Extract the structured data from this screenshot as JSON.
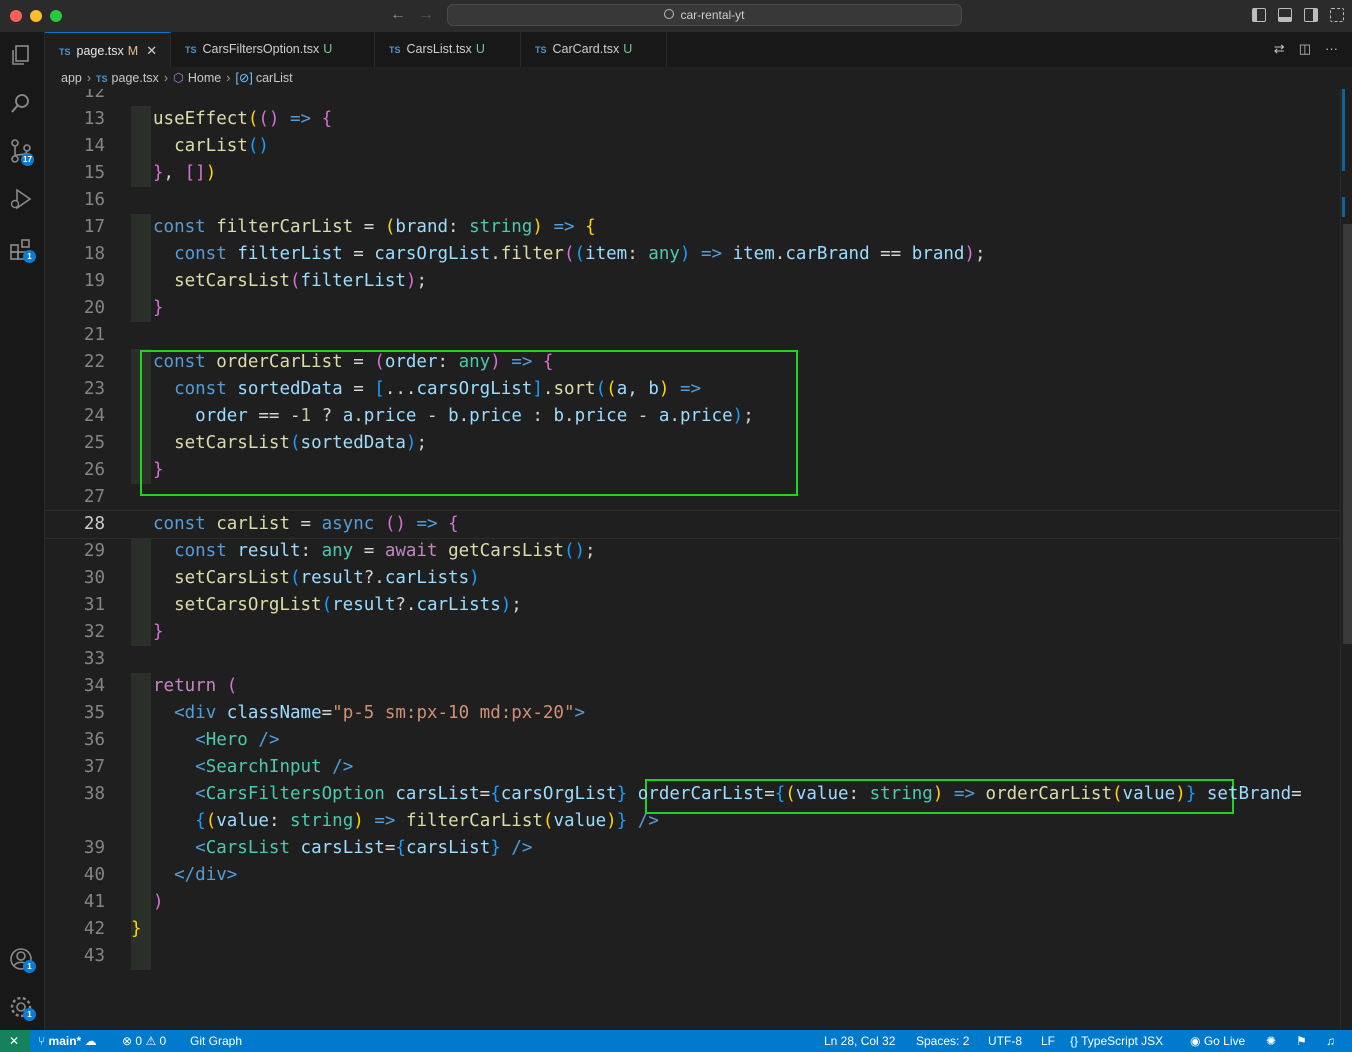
{
  "window": {
    "search_text": "car-rental-yt",
    "traffic_lights": {
      "close": "#ff5f57",
      "min": "#febc2e",
      "max": "#28c840"
    }
  },
  "activity_bar": {
    "items": [
      {
        "icon": "files-icon"
      },
      {
        "icon": "search-icon"
      },
      {
        "icon": "source-control-icon",
        "badge": "17"
      },
      {
        "icon": "run-debug-icon"
      },
      {
        "icon": "extensions-icon",
        "badge": "1"
      }
    ],
    "bottom": [
      {
        "icon": "account-icon",
        "badge": "1"
      },
      {
        "icon": "settings-gear-icon",
        "badge": "1"
      }
    ]
  },
  "tabs": [
    {
      "lang": "TS",
      "label": "page.tsx",
      "status": "M",
      "active": true
    },
    {
      "lang": "TS",
      "label": "CarsFiltersOption.tsx",
      "status": "U"
    },
    {
      "lang": "TS",
      "label": "CarsList.tsx",
      "status": "U"
    },
    {
      "lang": "TS",
      "label": "CarCard.tsx",
      "status": "U"
    }
  ],
  "breadcrumb": {
    "folder": "app",
    "file_lang": "TS",
    "file": "page.tsx",
    "component": "Home",
    "symbol": "carList"
  },
  "line_numbers": [
    "12",
    "13",
    "14",
    "15",
    "16",
    "17",
    "18",
    "19",
    "20",
    "21",
    "22",
    "23",
    "24",
    "25",
    "26",
    "27",
    "28",
    "29",
    "30",
    "31",
    "32",
    "33",
    "34",
    "35",
    "36",
    "37",
    "38",
    "",
    "39",
    "40",
    "41",
    "42",
    "43"
  ],
  "current_line": "28",
  "status_bar": {
    "branch": "main*",
    "errors": "0",
    "warnings": "0",
    "git_graph": "Git Graph",
    "position": "Ln 28, Col 32",
    "spaces": "Spaces: 2",
    "encoding": "UTF-8",
    "eol": "LF",
    "language": "TypeScript JSX",
    "go_live": "Go Live"
  },
  "colors": {
    "accent": "#007acc",
    "highlight_box": "#1ed41e"
  }
}
